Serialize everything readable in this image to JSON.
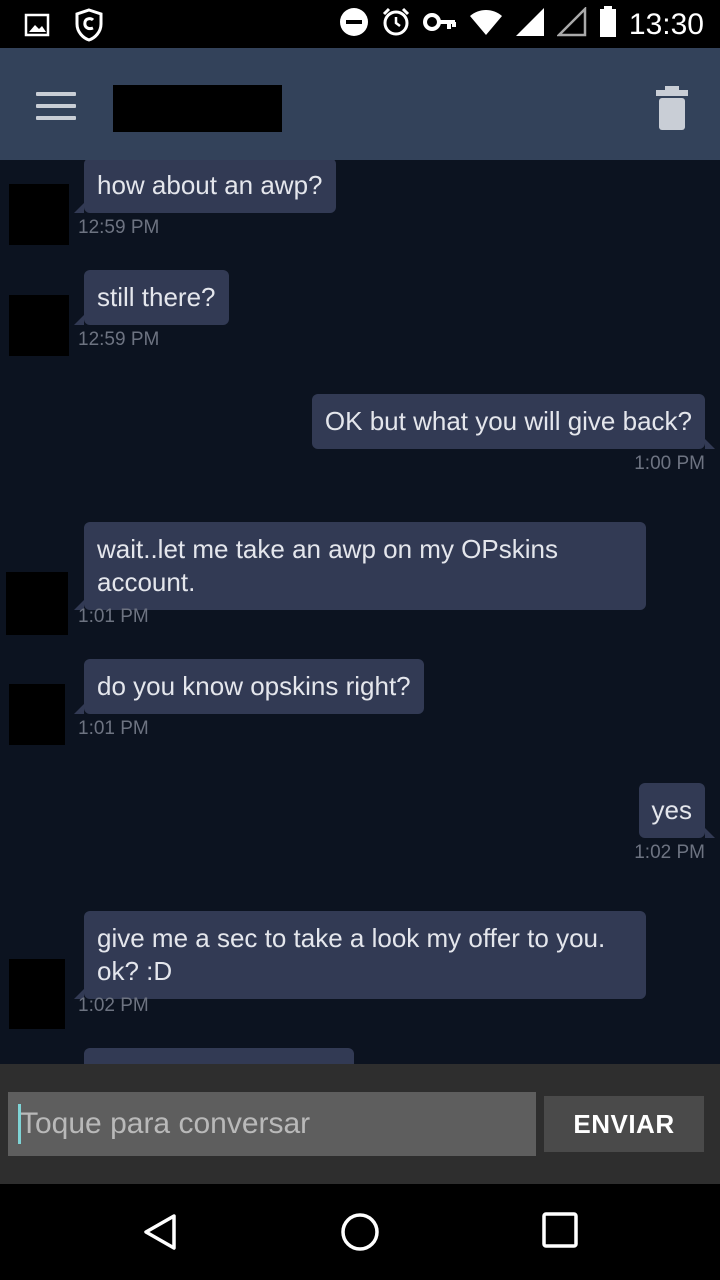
{
  "status_bar": {
    "time": "13:30",
    "icons": [
      "image-icon",
      "shield-icon",
      "do-not-disturb-icon",
      "alarm-icon",
      "vpn-key-icon",
      "wifi-icon",
      "signal-icon",
      "signal-empty-icon",
      "battery-icon"
    ]
  },
  "app_bar": {
    "menu_icon": "hamburger-menu-icon",
    "title_redacted": true,
    "action_icon": "trash-icon"
  },
  "messages": [
    {
      "direction": "in",
      "text": "how about an awp?",
      "time": "12:59 PM"
    },
    {
      "direction": "in",
      "text": "still there?",
      "time": "12:59 PM"
    },
    {
      "direction": "out",
      "text": "OK but what you will give back?",
      "time": "1:00 PM"
    },
    {
      "direction": "in",
      "text": "wait..let me take an awp on my OPskins account.",
      "time": "1:01 PM"
    },
    {
      "direction": "in",
      "text": "do you know opskins right?",
      "time": "1:01 PM"
    },
    {
      "direction": "out",
      "text": "yes",
      "time": "1:02 PM"
    },
    {
      "direction": "in",
      "text": "give me a sec to take a look my offer to you. ok? :D",
      "time": "1:02 PM"
    },
    {
      "direction": "in",
      "text": "",
      "time": ""
    }
  ],
  "input": {
    "placeholder": "Toque para conversar",
    "value": "",
    "send_label": "ENVIAR"
  },
  "nav_bar": {
    "icons": [
      "back-icon",
      "home-icon",
      "recents-icon"
    ]
  },
  "colors": {
    "app_bar": "#33425a",
    "chat_bg": "#0c1320",
    "bubble": "#323a54",
    "timestamp": "#6d7381"
  }
}
